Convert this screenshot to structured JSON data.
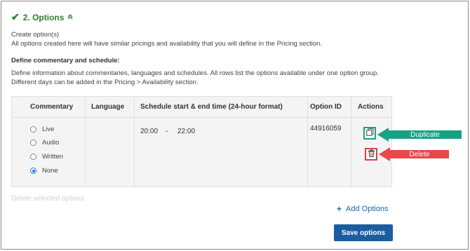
{
  "section": {
    "title": "2. Options",
    "check_icon": "check-icon",
    "collapse_icon": "chevron-up-icon"
  },
  "intro": {
    "line1": "Create option(s)",
    "line2": "All options created here will have similar pricings and availability that you will define in the Pricing section."
  },
  "commentary": {
    "heading": "Define commentary and schedule:",
    "line1": "Define information about commentaries, languages and schedules. All rows list the options available under one option group.",
    "line2": "Different days can be added in the Pricing > Availability section."
  },
  "table": {
    "headers": [
      "Commentary",
      "Language",
      "Schedule start & end time (24-hour format)",
      "Option ID",
      "Actions"
    ],
    "commentary_options": [
      {
        "label": "Live",
        "selected": false
      },
      {
        "label": "Audio",
        "selected": false
      },
      {
        "label": "Written",
        "selected": false
      },
      {
        "label": "None",
        "selected": true
      }
    ],
    "schedule_start": "20:00",
    "schedule_separator": "-",
    "schedule_end": "22:00",
    "option_id": "44916059"
  },
  "actions": {
    "duplicate_icon": "copy-icon",
    "delete_icon": "trash-icon"
  },
  "annotations": {
    "duplicate_label": "Duplicate",
    "duplicate_color": "#19a186",
    "delete_label": "Delete",
    "delete_color": "#e8484a"
  },
  "footer": {
    "delete_selected": "Delete selected options",
    "add_options": "Add Options",
    "save_options": "Save options"
  },
  "colors": {
    "accent_green": "#2e7d32",
    "link_blue": "#1a66b3",
    "button_blue": "#1b5d9e"
  }
}
